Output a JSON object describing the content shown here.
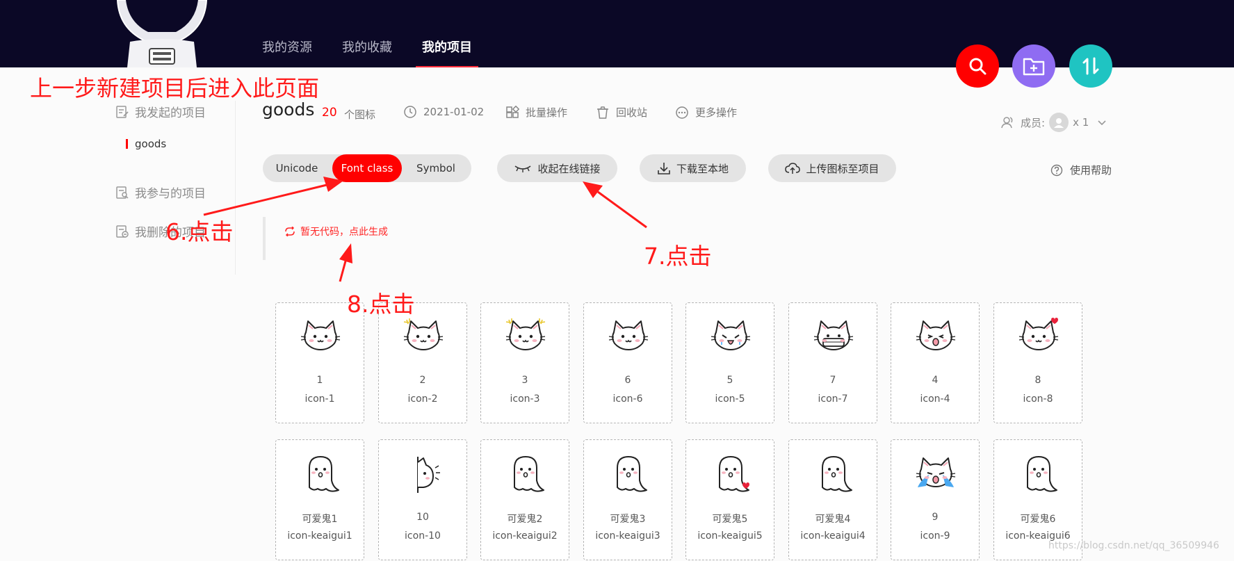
{
  "nav": {
    "items": [
      {
        "label": "我的资源"
      },
      {
        "label": "我的收藏"
      },
      {
        "label": "我的项目"
      }
    ]
  },
  "sidebar": {
    "initiated": "我发起的项目",
    "sub_item": "goods",
    "participated": "我参与的项目",
    "deleted": "我删除的项目"
  },
  "project": {
    "name": "goods",
    "count": "20",
    "count_unit": "个图标",
    "date": "2021-01-02",
    "batch": "批量操作",
    "recycle": "回收站",
    "more": "更多操作",
    "members_label": "成员:",
    "members_count": "x 1"
  },
  "tabs": [
    {
      "label": "Unicode"
    },
    {
      "label": "Font class"
    },
    {
      "label": "Symbol"
    }
  ],
  "actions": {
    "collapse_link": "收起在线链接",
    "download": "下载至本地",
    "upload": "上传图标至项目",
    "help": "使用帮助"
  },
  "code": {
    "generate": "暂无代码，点此生成"
  },
  "icons": [
    {
      "name": "1",
      "code": "icon-1",
      "kind": "cat",
      "extra": "none"
    },
    {
      "name": "2",
      "code": "icon-2",
      "kind": "cat",
      "extra": "spark-left"
    },
    {
      "name": "3",
      "code": "icon-3",
      "kind": "cat",
      "extra": "spark-both"
    },
    {
      "name": "6",
      "code": "icon-6",
      "kind": "cat",
      "extra": "none"
    },
    {
      "name": "5",
      "code": "icon-5",
      "kind": "cat",
      "extra": "cry"
    },
    {
      "name": "7",
      "code": "icon-7",
      "kind": "cat",
      "extra": "mask"
    },
    {
      "name": "4",
      "code": "icon-4",
      "kind": "cat",
      "extra": "shout"
    },
    {
      "name": "8",
      "code": "icon-8",
      "kind": "cat",
      "extra": "heart"
    },
    {
      "name": "可爱鬼1",
      "code": "icon-keaigui1",
      "kind": "ghost",
      "extra": "none"
    },
    {
      "name": "10",
      "code": "icon-10",
      "kind": "peek",
      "extra": "none"
    },
    {
      "name": "可爱鬼2",
      "code": "icon-keaigui2",
      "kind": "ghost",
      "extra": "none"
    },
    {
      "name": "可爱鬼3",
      "code": "icon-keaigui3",
      "kind": "ghost",
      "extra": "none"
    },
    {
      "name": "可爱鬼5",
      "code": "icon-keaigui5",
      "kind": "ghost",
      "extra": "heart"
    },
    {
      "name": "可爱鬼4",
      "code": "icon-keaigui4",
      "kind": "ghost",
      "extra": "none"
    },
    {
      "name": "9",
      "code": "icon-9",
      "kind": "cat",
      "extra": "tears"
    },
    {
      "name": "可爱鬼6",
      "code": "icon-keaigui6",
      "kind": "ghost",
      "extra": "none"
    }
  ],
  "annotations": {
    "title": "上一步新建项目后进入此页面",
    "step6": "6.点击",
    "step7": "7.点击",
    "step8": "8.点击"
  },
  "watermark": "https://blog.csdn.net/qq_36509946",
  "colors": {
    "header_bg": "#0b0826",
    "accent_red": "#ff0000",
    "folder_purple": "#8f6cf2",
    "sort_teal": "#1fc4c2"
  }
}
